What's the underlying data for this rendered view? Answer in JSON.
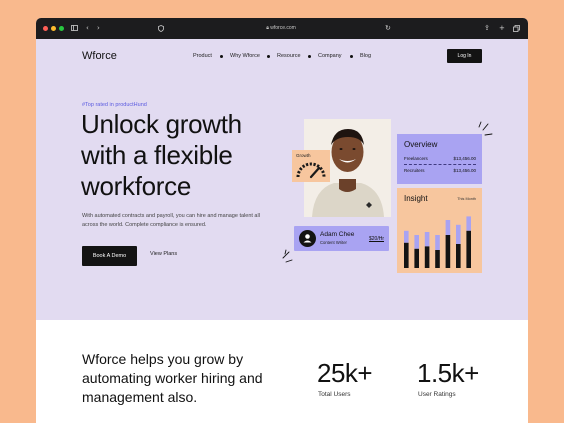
{
  "browser": {
    "url": "wforce.com"
  },
  "site": {
    "logo": "Wforce",
    "nav": [
      "Product",
      "Why Wforce",
      "Resource",
      "Company",
      "Blog"
    ],
    "login_label": "Log In"
  },
  "hero": {
    "tagline": "#Top rated in productHund",
    "headline": "Unlock growth with a flexible workforce",
    "subtext": "With automated contracts and payroll, you can hire and manage talent all across the world. Complete compliance is ensured.",
    "primary_cta": "Book A Demo",
    "secondary_cta": "View Plans"
  },
  "growth_card": {
    "label": "Growth"
  },
  "person_card": {
    "name": "Adam Chee",
    "role": "Content Writer",
    "rate": "$20/Hr"
  },
  "overview_card": {
    "title": "Overview",
    "rows": [
      {
        "label": "Freelancers",
        "value": "$13,456.00"
      },
      {
        "label": "Recruiters",
        "value": "$13,456.00"
      }
    ]
  },
  "insight_card": {
    "title": "Insight",
    "period": "This Month",
    "bars": [
      {
        "total": 0.62,
        "dark": 0.42
      },
      {
        "total": 0.55,
        "dark": 0.32
      },
      {
        "total": 0.6,
        "dark": 0.36
      },
      {
        "total": 0.55,
        "dark": 0.3
      },
      {
        "total": 0.8,
        "dark": 0.55
      },
      {
        "total": 0.72,
        "dark": 0.4
      },
      {
        "total": 0.86,
        "dark": 0.62
      }
    ]
  },
  "stats": {
    "text": "Wforce helps you grow by automating worker hiring and management also.",
    "items": [
      {
        "value": "25k+",
        "label": "Total Users"
      },
      {
        "value": "1.5k+",
        "label": "User Ratings"
      }
    ]
  },
  "colors": {
    "background": "#F9B98D",
    "hero_bg": "#E2DBF1",
    "lavender_card": "#A9A3F2",
    "peach_card": "#F7C69E",
    "dark": "#131313",
    "accent": "#5B5BE0"
  }
}
